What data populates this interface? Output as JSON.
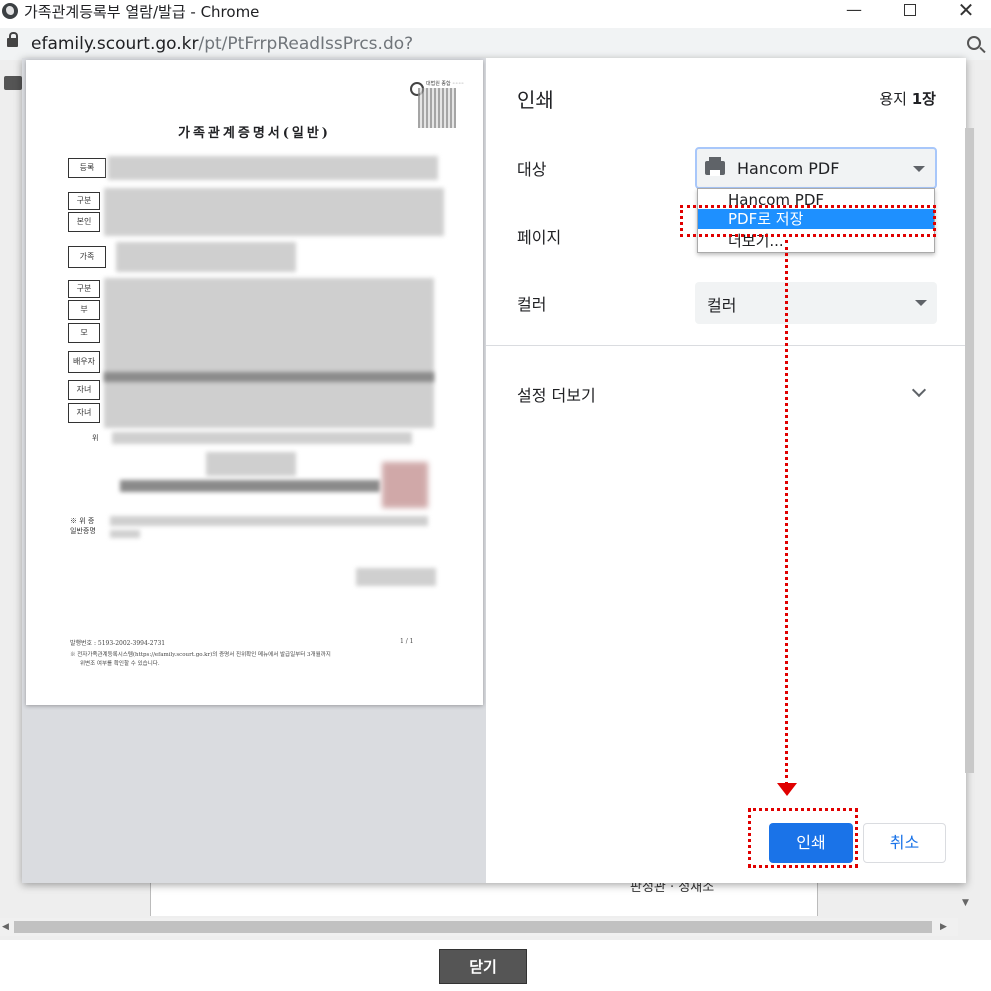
{
  "window": {
    "title": "가족관계등록부 열람/발급 - Chrome",
    "minimize": "—",
    "close": "✕"
  },
  "address_bar": {
    "host": "efamily.scourt.go.kr",
    "path": "/pt/PtFrrpReadIssPrcs.do?"
  },
  "background_page": {
    "close_button": "닫기",
    "partial_footer_text": "판정관 · 정새소"
  },
  "preview": {
    "doc_title": "가족관계증명서(일반)",
    "qr_caption": "대법원 종합 ◦◦◦◦",
    "labels": [
      "등록",
      "구분",
      "본인",
      "가족",
      "구분",
      "부",
      "모",
      "배우자",
      "자녀",
      "자녀"
    ],
    "note_1": "※ 위 증",
    "note_2": "일반증명",
    "issue_number": "발행번호 : 5193-2002-3994-2731",
    "page_indicator": "1  /  1",
    "footer_line_1": "※ 전자가족관계등록시스템(https://efamily.scourt.go.kr)의 증명서 진위확인 메뉴에서 발급일부터 3개월까지",
    "footer_line_2": "위변조 여부를 확인할 수 있습니다.",
    "under_label": "위"
  },
  "print_dialog": {
    "title": "인쇄",
    "sheet_count_prefix": "용지",
    "sheet_count": "1장",
    "destination_label": "대상",
    "destination_value": "Hancom PDF",
    "destination_options": [
      "Hancom PDF",
      "PDF로 저장",
      "더보기..."
    ],
    "pages_label": "페이지",
    "color_label": "컬러",
    "color_value": "컬러",
    "more_settings_label": "설정 더보기",
    "print_button": "인쇄",
    "cancel_button": "취소"
  },
  "colors": {
    "accent": "#1a73e8",
    "highlight": "#1e90ff",
    "annotation": "#e00000"
  }
}
